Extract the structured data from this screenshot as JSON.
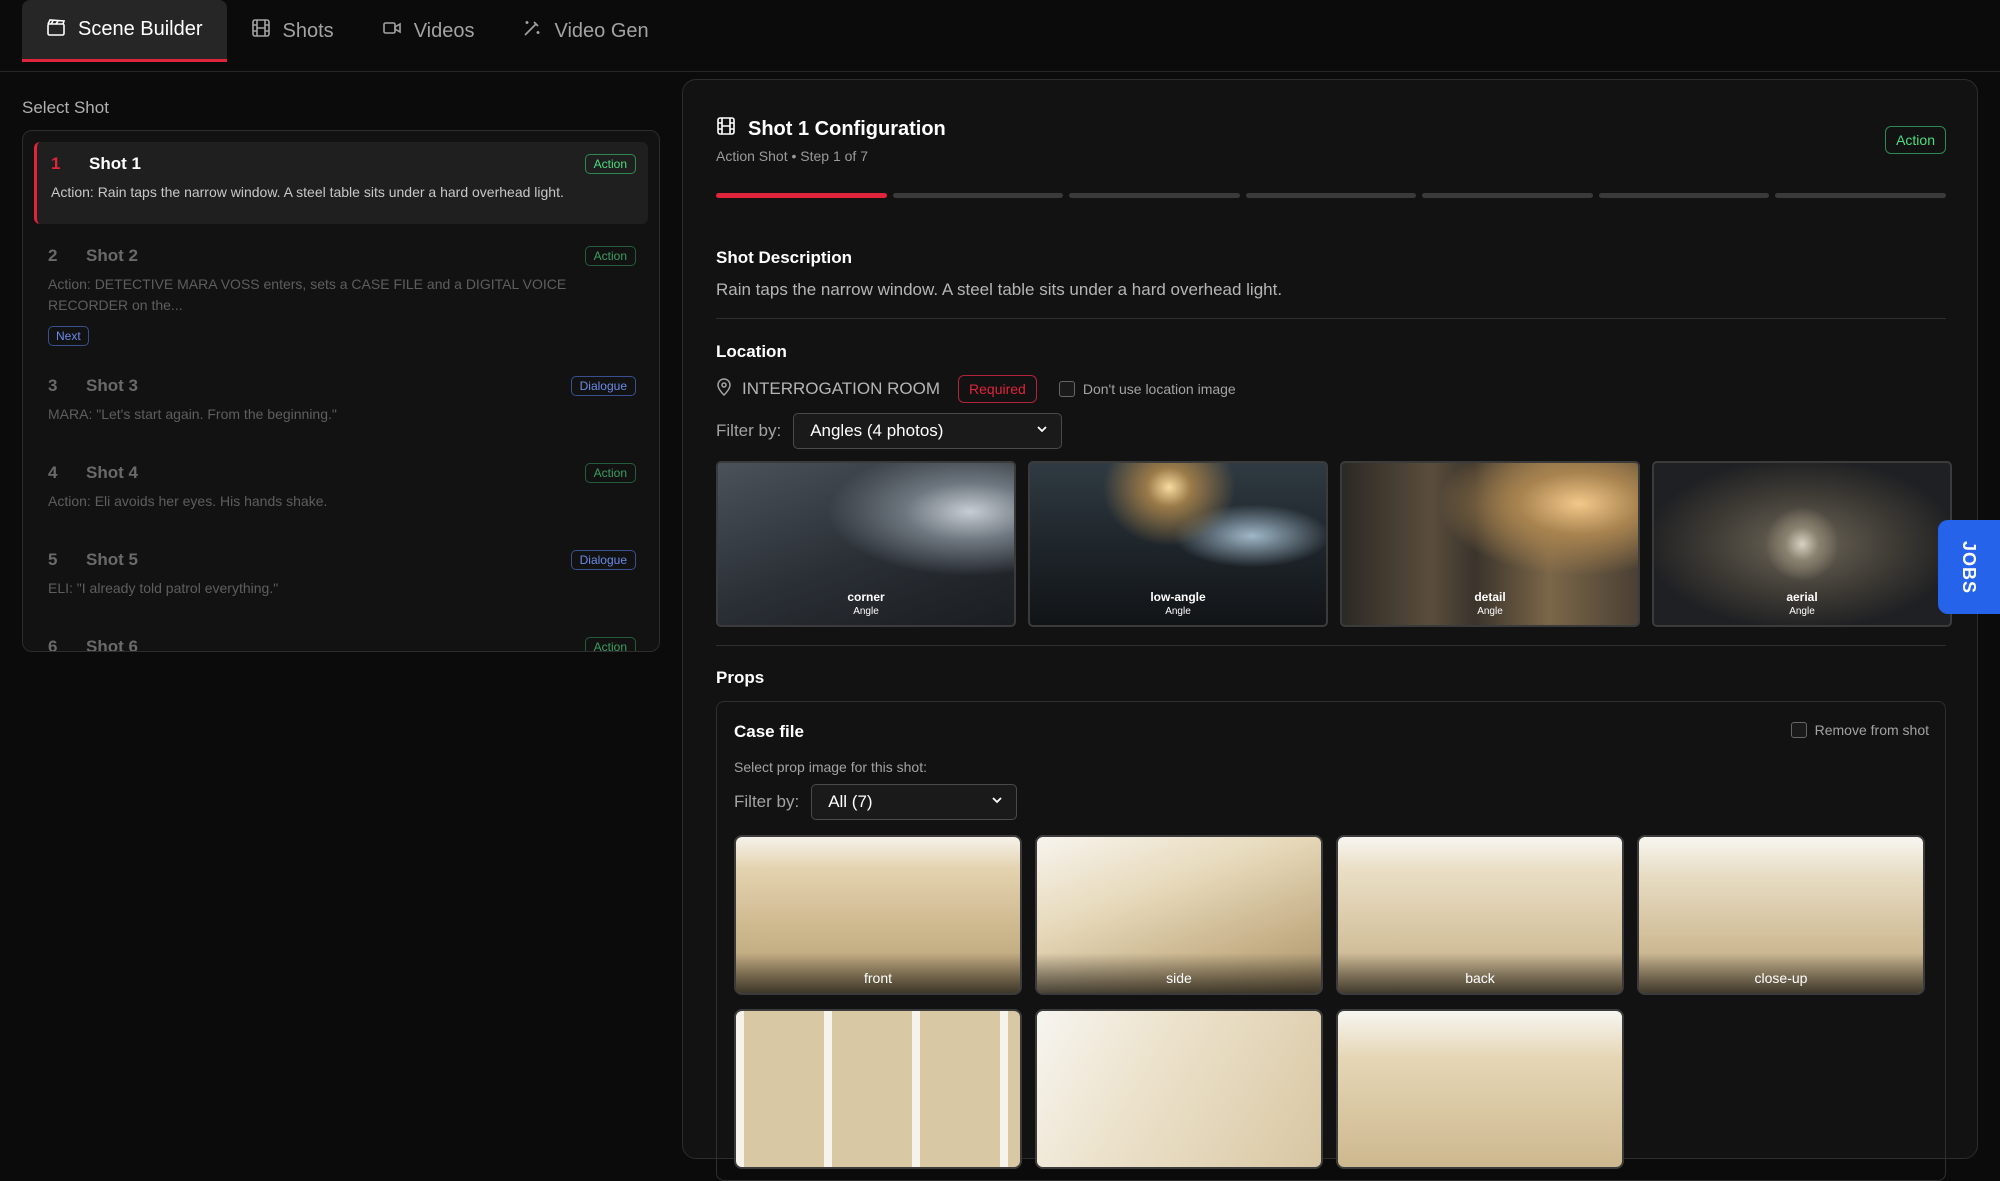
{
  "tabs": [
    {
      "label": "Scene Builder",
      "icon": "clapperboard-icon",
      "active": true
    },
    {
      "label": "Shots",
      "icon": "film-icon"
    },
    {
      "label": "Videos",
      "icon": "video-camera-icon"
    },
    {
      "label": "Video Gen",
      "icon": "magic-wand-icon"
    }
  ],
  "sidebar": {
    "title": "Select Shot",
    "shots": [
      {
        "num": "1",
        "name": "Shot 1",
        "badge": "Action",
        "desc": "Action: Rain taps the narrow window. A steel table sits under a hard overhead light."
      },
      {
        "num": "2",
        "name": "Shot 2",
        "badge": "Action",
        "desc": "Action: DETECTIVE MARA VOSS enters, sets a CASE FILE and a DIGITAL VOICE RECORDER on the...",
        "tag": "Next"
      },
      {
        "num": "3",
        "name": "Shot 3",
        "badge": "Dialogue",
        "desc": "MARA: \"Let's start again. From the beginning.\""
      },
      {
        "num": "4",
        "name": "Shot 4",
        "badge": "Action",
        "desc": "Action: Eli avoids her eyes. His hands shake."
      },
      {
        "num": "5",
        "name": "Shot 5",
        "badge": "Dialogue",
        "desc": "ELI: \"I already told patrol everything.\""
      },
      {
        "num": "6",
        "name": "Shot 6",
        "badge": "Action",
        "desc": ""
      }
    ]
  },
  "config": {
    "title": "Shot 1 Configuration",
    "subtitle": "Action Shot • Step 1 of 7",
    "badge": "Action",
    "progress": {
      "current": 1,
      "total": 7
    },
    "description_label": "Shot Description",
    "description": "Rain taps the narrow window. A steel table sits under a hard overhead light.",
    "location_label": "Location",
    "location_name": "INTERROGATION ROOM",
    "required_label": "Required",
    "no_location_label": "Don't use location image",
    "filter_label": "Filter by:",
    "location_filter": "Angles (4 photos)",
    "angles": [
      {
        "name": "corner",
        "type": "Angle"
      },
      {
        "name": "low-angle",
        "type": "Angle"
      },
      {
        "name": "detail",
        "type": "Angle"
      },
      {
        "name": "aerial",
        "type": "Angle"
      }
    ],
    "props_label": "Props",
    "prop": {
      "title": "Case file",
      "remove_label": "Remove from shot",
      "select_label": "Select prop image for this shot:",
      "filter_label": "Filter by:",
      "filter_value": "All (7)",
      "images": [
        "front",
        "side",
        "back",
        "close-up",
        "",
        "",
        ""
      ]
    }
  },
  "jobs_label": "JOBS",
  "colors": {
    "accent": "#e0243c",
    "action": "#4ade80",
    "dialogue": "#6b8be8",
    "jobs": "#2563eb"
  }
}
